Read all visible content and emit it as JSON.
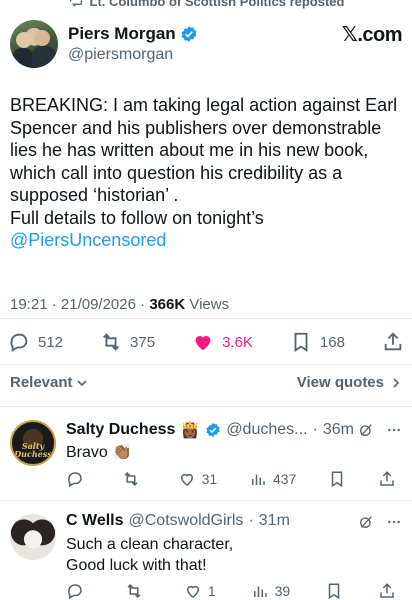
{
  "repost_bar": {
    "text": "Lt. Columbo of Scottish Politics reposted"
  },
  "author": {
    "name": "Piers Morgan",
    "handle": "@piersmorgan",
    "brand": "𝕏.com"
  },
  "tweet": {
    "text": "BREAKING: I am taking legal action against Earl Spencer and his publishers over demonstrable lies he has written about me in his new book, which call into question his credibility as a supposed ‘historian’ .\nFull details to follow on tonight’s",
    "link": "@PiersUncensored"
  },
  "meta": {
    "time": "19:21",
    "date": "21/09/2026",
    "views_count": "366K",
    "views_label": "Views"
  },
  "actions": {
    "replies": "512",
    "reposts": "375",
    "likes": "3.6K",
    "bookmarks": "168"
  },
  "sort": {
    "relevant": "Relevant",
    "view_quotes": "View quotes"
  },
  "replies": [
    {
      "name": "Salty Duchess",
      "emoji": "👸🏾",
      "handle": "@duches...",
      "time": "36m",
      "avatar_text": "Salty Duchess",
      "body": "Bravo 👏🏽",
      "replies": "",
      "reposts": "",
      "likes": "31",
      "views": "437"
    },
    {
      "name": "C Wells",
      "handle": "@CotswoldGirls",
      "time": "31m",
      "body": "Such a clean character,\nGood luck with that!",
      "replies": "",
      "reposts": "",
      "likes": "1",
      "views": "39"
    }
  ],
  "colors": {
    "accent": "#1d9bf0",
    "like": "#f91880",
    "muted": "#536471",
    "text": "#0f1419"
  }
}
